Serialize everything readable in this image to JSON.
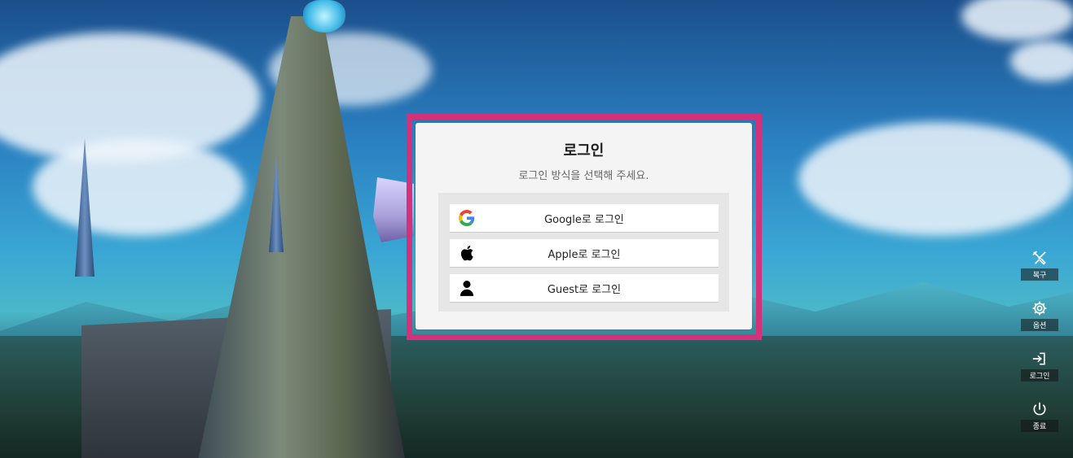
{
  "dialog": {
    "title": "로그인",
    "subtitle": "로그인 방식을 선택해 주세요.",
    "options": [
      {
        "label": "Google로 로그인",
        "icon": "google-icon"
      },
      {
        "label": "Apple로 로그인",
        "icon": "apple-icon"
      },
      {
        "label": "Guest로 로그인",
        "icon": "guest-person-icon"
      }
    ]
  },
  "side_menu": [
    {
      "label": "복구",
      "icon": "repair-tools-icon"
    },
    {
      "label": "옵션",
      "icon": "gear-icon"
    },
    {
      "label": "로그인",
      "icon": "login-icon"
    },
    {
      "label": "종료",
      "icon": "power-icon"
    }
  ],
  "colors": {
    "highlight": "#d5307a",
    "dialog_bg": "#f4f4f4",
    "options_bg": "#e6e6e6"
  }
}
